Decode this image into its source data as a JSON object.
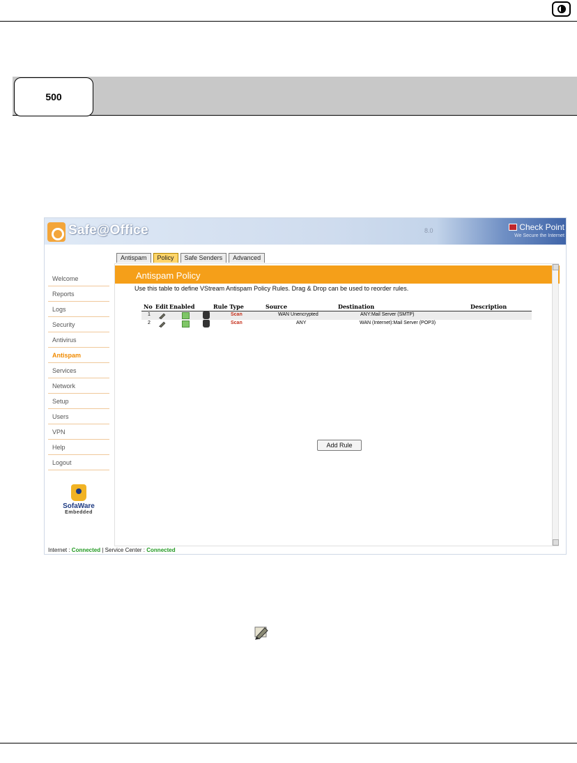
{
  "page": {
    "badge": "500"
  },
  "app": {
    "title": "Safe@Office",
    "header_mid": "8.0",
    "vendor_name": "Check Point",
    "vendor_tagline": "We Secure the Internet"
  },
  "tabs": [
    {
      "label": "Antispam"
    },
    {
      "label": "Policy"
    },
    {
      "label": "Safe Senders"
    },
    {
      "label": "Advanced"
    }
  ],
  "nav": [
    {
      "label": "Welcome"
    },
    {
      "label": "Reports"
    },
    {
      "label": "Logs"
    },
    {
      "label": "Security"
    },
    {
      "label": "Antivirus"
    },
    {
      "label": "Antispam"
    },
    {
      "label": "Services"
    },
    {
      "label": "Network"
    },
    {
      "label": "Setup"
    },
    {
      "label": "Users"
    },
    {
      "label": "VPN"
    },
    {
      "label": "Help"
    },
    {
      "label": "Logout"
    }
  ],
  "brand": {
    "name": "SofaWare",
    "sub": "Embedded"
  },
  "policy": {
    "title": "Antispam Policy",
    "description": "Use this table to define VStream Antispam Policy Rules. Drag & Drop can be used to reorder rules.",
    "columns": {
      "no": "No",
      "edit": "Edit",
      "enabled": "Enabled",
      "rule_type": "Rule Type",
      "source": "Source",
      "destination": "Destination",
      "description": "Description"
    },
    "rows": [
      {
        "no": "1",
        "type": "Scan",
        "source": "WAN Unencrypted",
        "destination": "ANY:Mail Server (SMTP)"
      },
      {
        "no": "2",
        "type": "Scan",
        "source": "ANY",
        "destination": "WAN (Internet):Mail Server (POP3)"
      }
    ],
    "add_rule": "Add Rule"
  },
  "status": {
    "internet_label": "Internet : ",
    "internet_value": "Connected",
    "sep": " | Service Center : ",
    "service_value": "Connected"
  },
  "colors": {
    "accent_orange": "#f59f19",
    "active_nav": "#f08a00",
    "scan_red": "#c5301b",
    "connected_green": "#229922"
  }
}
